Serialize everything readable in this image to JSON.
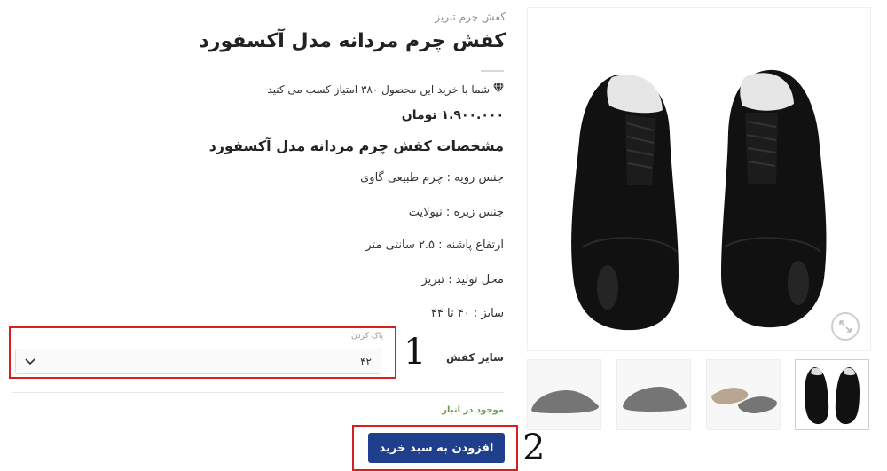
{
  "product": {
    "breadcrumb": "کفش چرم تبریز",
    "title": "کفش چرم مردانه مدل آکسفورد",
    "points_text": "شما با خرید این محصول ۳۸۰ امتیاز کسب می کنید",
    "price": "۱.۹۰۰.۰۰۰ تومان",
    "spec_title": "مشخصات کفش چرم مردانه مدل آکسفورد",
    "specs": [
      "جنس رویه : چرم طبیعی گاوی",
      "جنس زیره : نیولایت",
      "ارتفاع پاشنه : ۲.۵ سانتی متر",
      "محل تولید : تبریز",
      "سایز : ۴۰ تا ۴۴"
    ]
  },
  "variation": {
    "label": "سایز کفش",
    "clear_link": "پاک کردن",
    "selected_value": "۴۲"
  },
  "stock_status": "موجود در انبار",
  "add_to_cart_label": "افزودن به سبد خرید",
  "annotations": {
    "one": "1",
    "two": "2"
  },
  "icons": {
    "points": "diamond-icon",
    "zoom": "expand-icon",
    "dropdown": "chevron-down-icon"
  },
  "colors": {
    "primary_button": "#1f3f8d",
    "highlight_box": "#d62020",
    "stock": "#6d9d52"
  }
}
